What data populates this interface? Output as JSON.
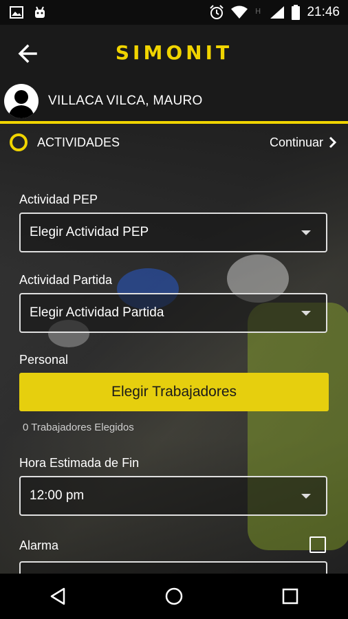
{
  "status_bar": {
    "time": "21:46",
    "icons": [
      "image-icon",
      "android-icon",
      "alarm-icon",
      "wifi-icon",
      "h-signal-icon",
      "signal-icon",
      "battery-icon"
    ]
  },
  "app_bar": {
    "logo_text": "SIMONIT",
    "back_icon": "arrow-back-icon"
  },
  "user": {
    "name": "VILLACA VILCA, MAURO"
  },
  "section": {
    "title": "ACTIVIDADES",
    "continue_label": "Continuar"
  },
  "form": {
    "actividad_pep_label": "Actividad PEP",
    "actividad_pep_value": "Elegir Actividad PEP",
    "actividad_partida_label": "Actividad Partida",
    "actividad_partida_value": "Elegir Actividad Partida",
    "personal_label": "Personal",
    "elegir_trabajadores_label": "Elegir Trabajadores",
    "trabajadores_elegidos": "0 Trabajadores Elegidos",
    "hora_label": "Hora Estimada de Fin",
    "hora_value": "12:00 pm",
    "alarma_label": "Alarma"
  },
  "colors": {
    "accent": "#f0d400",
    "button": "#e6cf0e",
    "bar": "#1a1a1a"
  },
  "nav_bar": {
    "icons": [
      "nav-back-icon",
      "nav-home-icon",
      "nav-recents-icon"
    ]
  }
}
